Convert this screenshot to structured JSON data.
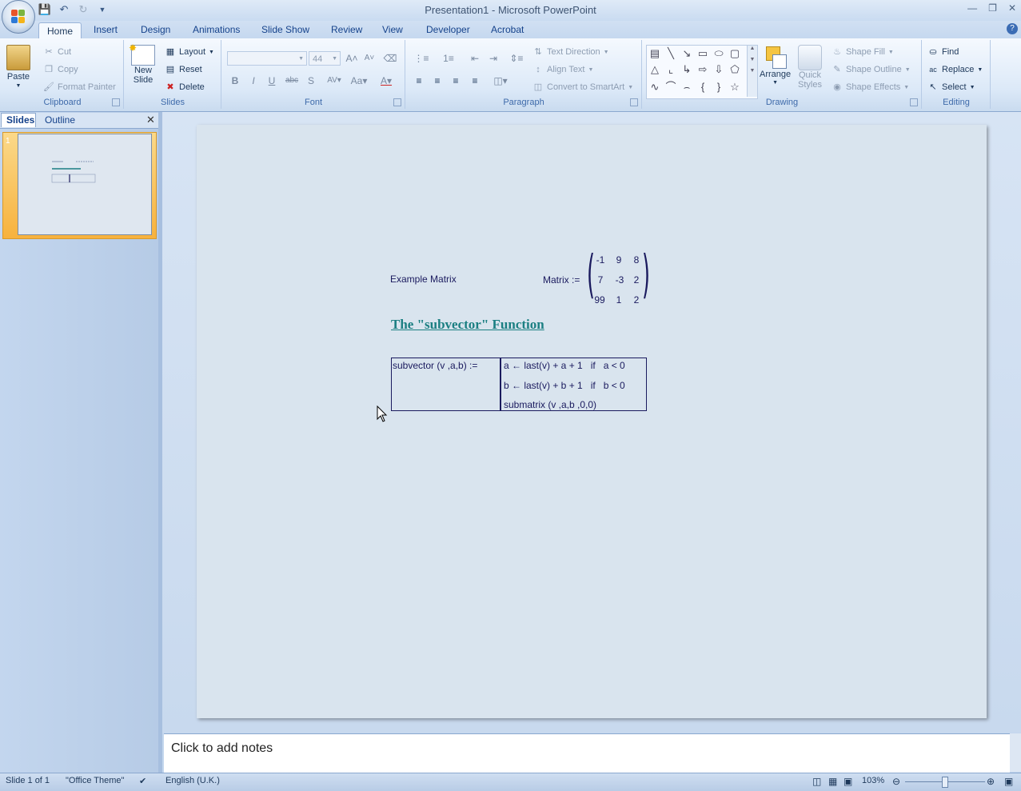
{
  "window": {
    "title": "Presentation1 - Microsoft PowerPoint"
  },
  "ribbon_tabs": [
    "Home",
    "Insert",
    "Design",
    "Animations",
    "Slide Show",
    "Review",
    "View",
    "Developer",
    "Acrobat"
  ],
  "clipboard": {
    "paste": "Paste",
    "cut": "Cut",
    "copy": "Copy",
    "format_painter": "Format Painter",
    "label": "Clipboard"
  },
  "slides_group": {
    "new_slide_1": "New",
    "new_slide_2": "Slide",
    "layout": "Layout",
    "reset": "Reset",
    "delete": "Delete",
    "label": "Slides"
  },
  "font_group": {
    "font_size": "44",
    "label": "Font"
  },
  "paragraph_group": {
    "text_direction": "Text Direction",
    "align_text": "Align Text",
    "convert_smartart": "Convert to SmartArt",
    "label": "Paragraph"
  },
  "drawing_group": {
    "arrange": "Arrange",
    "quick_1": "Quick",
    "quick_2": "Styles",
    "shape_fill": "Shape Fill",
    "shape_outline": "Shape Outline",
    "shape_effects": "Shape Effects",
    "label": "Drawing"
  },
  "editing_group": {
    "find": "Find",
    "replace": "Replace",
    "select": "Select",
    "label": "Editing"
  },
  "left_pane": {
    "tab_slides": "Slides",
    "tab_outline": "Outline",
    "slide_number": "1"
  },
  "slide": {
    "example_label": "Example Matrix",
    "matrix_label": "Matrix :=",
    "matrix": [
      [
        "-1",
        "9",
        "8"
      ],
      [
        "7",
        "-3",
        "2"
      ],
      [
        "99",
        "1",
        "2"
      ]
    ],
    "heading": "The \"subvector\" Function",
    "def_lhs": "subvector (v ,a,b) :=",
    "program_lines": [
      "a ← last(v) + a + 1   if   a < 0",
      "b ← last(v) + b + 1   if   b < 0",
      "submatrix (v ,a,b ,0,0)"
    ]
  },
  "notes": {
    "placeholder": "Click to add notes"
  },
  "status": {
    "slide": "Slide 1 of 1",
    "theme": "\"Office Theme\"",
    "language": "English (U.K.)",
    "zoom": "103%"
  }
}
